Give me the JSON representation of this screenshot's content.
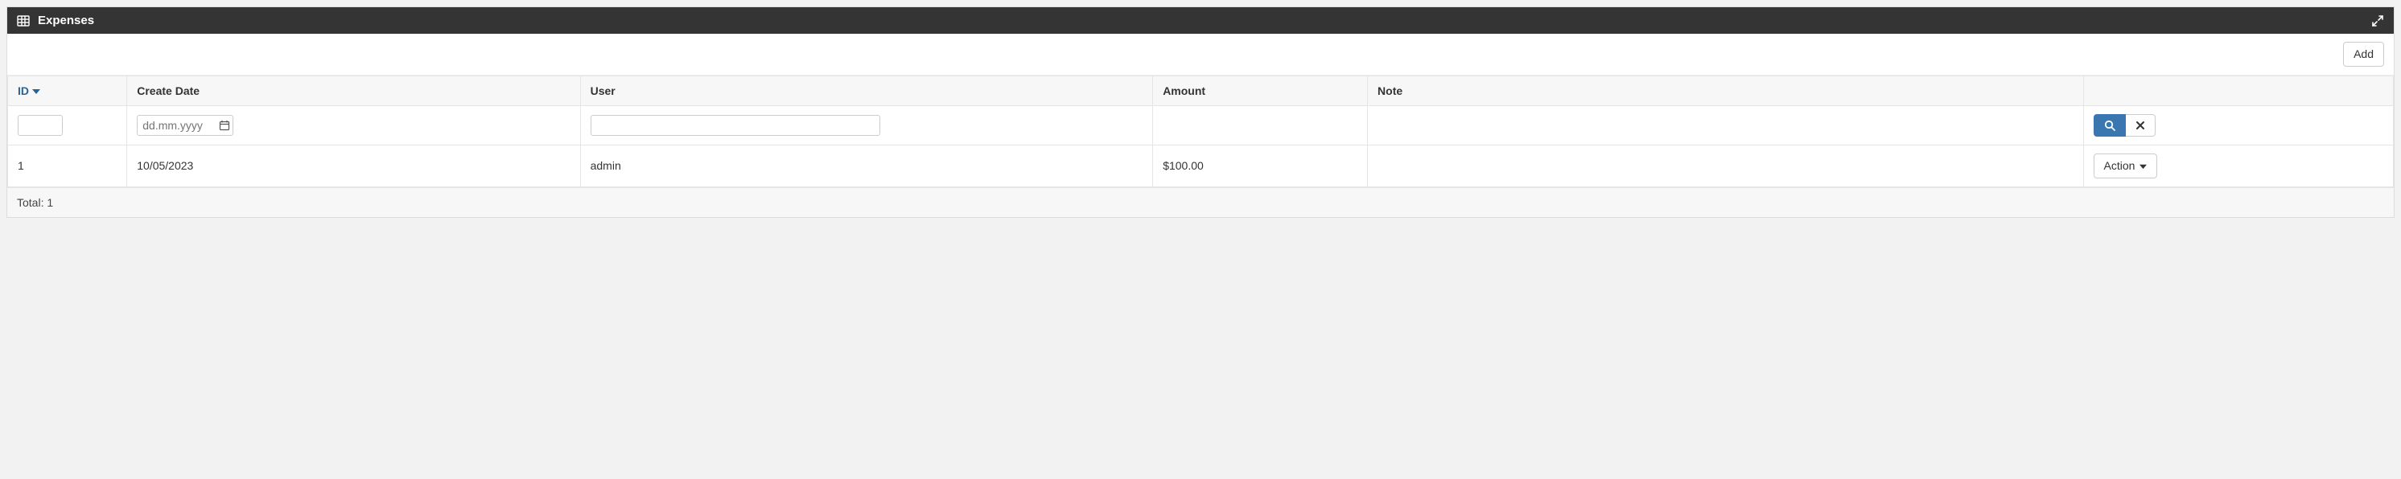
{
  "panel": {
    "title": "Expenses"
  },
  "toolbar": {
    "add_label": "Add"
  },
  "columns": {
    "id": "ID",
    "create_date": "Create Date",
    "user": "User",
    "amount": "Amount",
    "note": "Note"
  },
  "filters": {
    "date_placeholder": "dd.mm.yyyy",
    "id_value": "",
    "user_value": ""
  },
  "rows": [
    {
      "id": "1",
      "create_date": "10/05/2023",
      "user": "admin",
      "amount": "$100.00",
      "note": ""
    }
  ],
  "row_action_label": "Action",
  "footer": {
    "total_text": "Total: 1"
  }
}
